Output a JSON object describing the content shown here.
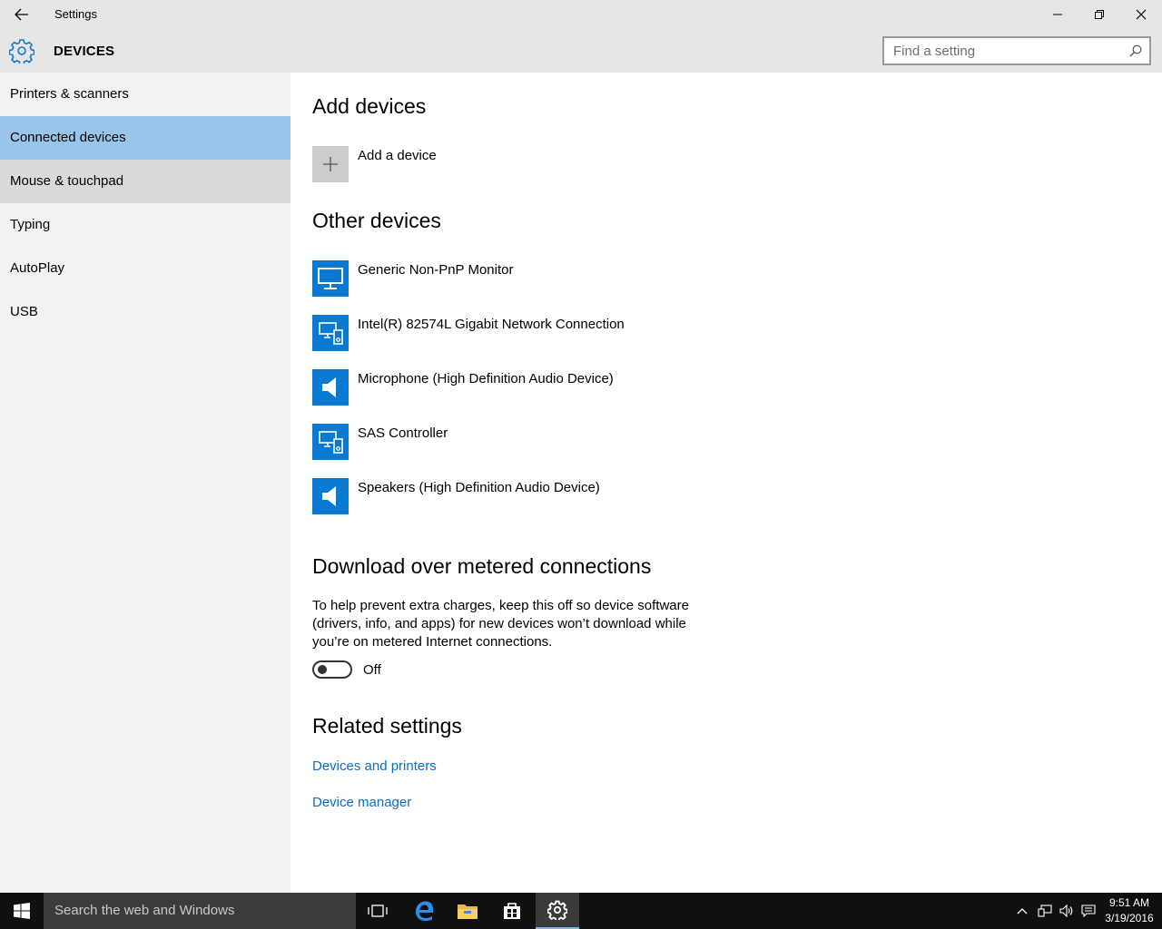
{
  "window": {
    "title": "Settings"
  },
  "header": {
    "section_title": "DEVICES",
    "search_placeholder": "Find a setting"
  },
  "sidebar": {
    "items": [
      {
        "label": "Printers & scanners"
      },
      {
        "label": "Connected devices"
      },
      {
        "label": "Mouse & touchpad"
      },
      {
        "label": "Typing"
      },
      {
        "label": "AutoPlay"
      },
      {
        "label": "USB"
      }
    ],
    "selected": "Connected devices"
  },
  "main": {
    "add_heading": "Add devices",
    "add_device_label": "Add a device",
    "other_heading": "Other devices",
    "devices": [
      {
        "label": "Generic Non-PnP Monitor",
        "icon": "monitor-icon"
      },
      {
        "label": "Intel(R) 82574L Gigabit Network Connection",
        "icon": "generic-device-icon"
      },
      {
        "label": "Microphone (High Definition Audio Device)",
        "icon": "speaker-icon"
      },
      {
        "label": "SAS Controller",
        "icon": "generic-device-icon"
      },
      {
        "label": "Speakers (High Definition Audio Device)",
        "icon": "speaker-icon"
      }
    ],
    "metered_heading": "Download over metered connections",
    "metered_desc": "To help prevent extra charges, keep this off so device software (drivers, info, and apps) for new devices won’t download while you’re on metered Internet connections.",
    "toggle_state": "Off",
    "related_heading": "Related settings",
    "links": [
      {
        "label": "Devices and printers"
      },
      {
        "label": "Device manager"
      }
    ]
  },
  "taskbar": {
    "search_text": "Search the web and Windows",
    "time": "9:51 AM",
    "date": "3/19/2016"
  },
  "colors": {
    "accent": "#0a79d1",
    "selected_nav": "#99c5ea",
    "link": "#0a6fc2"
  }
}
